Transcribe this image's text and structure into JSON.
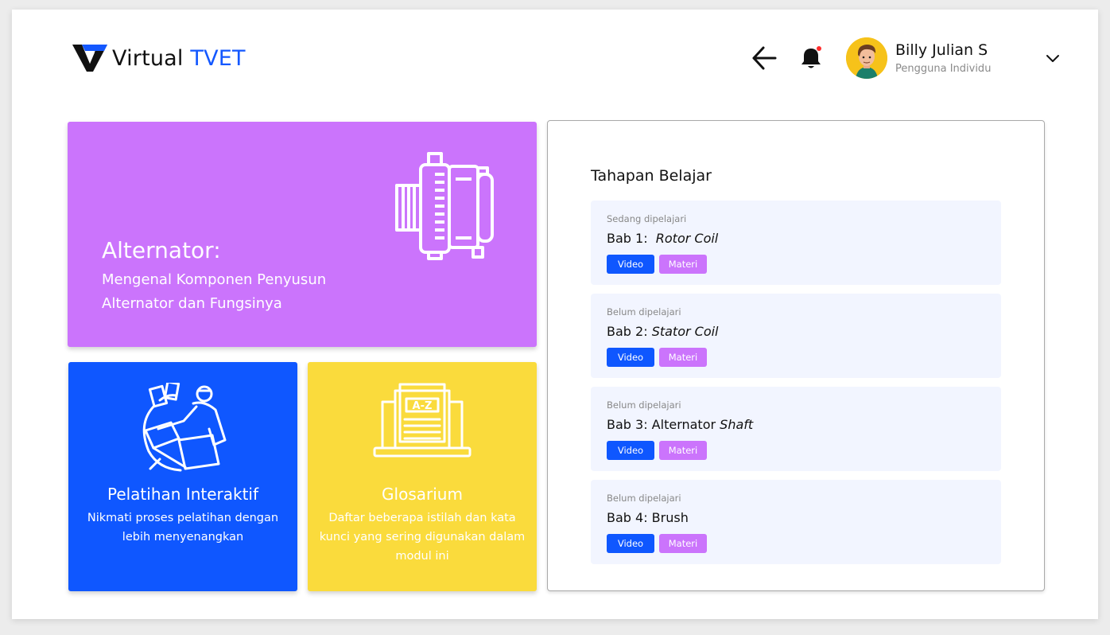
{
  "app": {
    "logo_text_main": "Virtual",
    "logo_text_accent": "TVET"
  },
  "header": {
    "back_icon": "arrow-left-icon",
    "notification_icon": "bell-icon",
    "notification_dot_color": "#ff2d2d",
    "user_name": "Billy Julian S",
    "user_role": "Pengguna Individu"
  },
  "hero": {
    "title": "Alternator:",
    "subtitle": "Mengenal Komponen Penyusun Alternator dan Fungsinya",
    "icon": "alternator-icon",
    "color": "#cb74fc"
  },
  "cards": [
    {
      "title": "Pelatihan Interaktif",
      "description": "Nikmati proses pelatihan dengan lebih menyenangkan",
      "icon": "interactive-training-icon",
      "color": "#0f57ff"
    },
    {
      "title": "Glosarium",
      "description": "Daftar beberapa istilah dan kata kunci yang sering digunakan dalam modul ini",
      "icon": "glossary-icon",
      "icon_label": "A-Z",
      "color": "#fadb3c"
    }
  ],
  "learning_path": {
    "title": "Tahapan Belajar",
    "steps": [
      {
        "status": "Sedang dipelajari",
        "prefix": "Bab 1:",
        "name": "Rotor Coil",
        "video_label": "Video",
        "materi_label": "Materi"
      },
      {
        "status": "Belum dipelajari",
        "prefix": "Bab 2:",
        "name": "Stator Coil",
        "video_label": "Video",
        "materi_label": "Materi"
      },
      {
        "status": "Belum dipelajari",
        "prefix": "Bab 3: Alternator",
        "name": "Shaft",
        "video_label": "Video",
        "materi_label": "Materi"
      },
      {
        "status": "Belum dipelajari",
        "prefix": "Bab 4: Brush",
        "name": "",
        "video_label": "Video",
        "materi_label": "Materi"
      }
    ]
  },
  "colors": {
    "primary_blue": "#0f57ff",
    "purple": "#cb74fc",
    "yellow": "#fadb3c",
    "step_bg": "#f2f5ff"
  }
}
